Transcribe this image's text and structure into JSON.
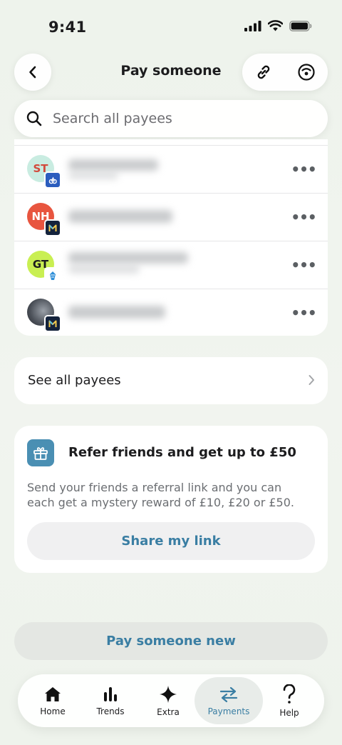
{
  "status_bar": {
    "time": "9:41"
  },
  "header": {
    "title": "Pay someone",
    "back_icon": "chevron-left-icon",
    "link_icon": "link-icon",
    "face_icon": "face-id-icon"
  },
  "search": {
    "placeholder": "Search all payees",
    "value": ""
  },
  "payees": [
    {
      "initials": "ST",
      "avatar_bg": "#c9ece1",
      "initials_color": "#d24a3c",
      "bank": "natwest",
      "bank_color": "#2b5dbe"
    },
    {
      "initials": "NH",
      "avatar_bg": "#e8553f",
      "initials_color": "#ffffff",
      "bank": "monzo",
      "bank_color": "#14233c"
    },
    {
      "initials": "GT",
      "avatar_bg": "#c9ef52",
      "initials_color": "#1c1c1e",
      "bank": "barclays",
      "bank_color": "#ffffff"
    },
    {
      "initials": "",
      "avatar_bg": "#4a4f57",
      "initials_color": "#ffffff",
      "bank": "monzo",
      "bank_color": "#14233c"
    }
  ],
  "see_all": {
    "label": "See all payees"
  },
  "refer": {
    "title": "Refer friends and get up to £50",
    "description": "Send your friends a referral link and you can each get a mystery reward of £10, £20 or £50.",
    "button": "Share my link"
  },
  "pay_new": {
    "label": "Pay someone new"
  },
  "tabs": [
    {
      "label": "Home",
      "icon": "home-icon",
      "active": false
    },
    {
      "label": "Trends",
      "icon": "bar-chart-icon",
      "active": false
    },
    {
      "label": "Extra",
      "icon": "sparkle-icon",
      "active": false
    },
    {
      "label": "Payments",
      "icon": "transfer-arrows-icon",
      "active": true
    },
    {
      "label": "Help",
      "icon": "question-icon",
      "active": false
    }
  ],
  "colors": {
    "accent": "#3a7ea3",
    "background": "#eef3ec"
  }
}
